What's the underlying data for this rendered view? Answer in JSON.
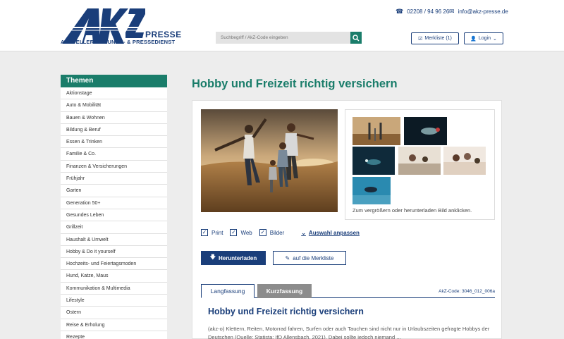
{
  "header": {
    "logo_presse": "PRESSE",
    "logo_tagline": "AKTUELLER ZEITUNGS- & PRESSEDIENST",
    "phone": "02208 / 94 96 26",
    "email": "info@akz-presse.de",
    "search_placeholder": "Suchbegriff / AkZ-Code eingeben",
    "merkliste_label": "Merkliste (1)",
    "login_label": "Login"
  },
  "sidebar": {
    "title": "Themen",
    "items": [
      "Aktionstage",
      "Auto & Mobilität",
      "Bauen & Wohnen",
      "Bildung & Beruf",
      "Essen & Trinken",
      "Familie & Co.",
      "Finanzen & Versicherungen",
      "Frühjahr",
      "Garten",
      "Generation 50+",
      "Gesundes Leben",
      "Grillzeit",
      "Haushalt & Umwelt",
      "Hobby & Do it yourself",
      "Hochzeits- und Feiertagsmoden",
      "Hund, Katze, Maus",
      "Kommunikation & Multimedia",
      "Lifestyle",
      "Ostern",
      "Reise & Erholung",
      "Rezepte"
    ]
  },
  "main": {
    "title": "Hobby und Freizeit richtig versichern",
    "thumb_caption": "Zum vergrößern oder herunterladen Bild anklicken.",
    "checks": [
      "Print",
      "Web",
      "Bilder"
    ],
    "adjust_label": "Auswahl anpassen",
    "download_label": "Herunterladen",
    "merkliste_add_label": "auf die Merkliste",
    "tab_long": "Langfassung",
    "tab_short": "Kurzfassung",
    "akz_code": "AkZ-Code: 3046_012_006a",
    "article_title": "Hobby und Freizeit richtig versichern",
    "article_text": "(akz-o) Klettern, Reiten, Motorrad fahren, Surfen oder auch Tauchen sind nicht nur in Urlaubszeiten gefragte Hobbys der Deutschen (Quelle: Statista: IfD Allensbach, 2021). Dabei sollte jedoch niemand ..."
  },
  "colors": {
    "brand_green": "#1a7d6a",
    "brand_blue": "#1a3e7a"
  }
}
